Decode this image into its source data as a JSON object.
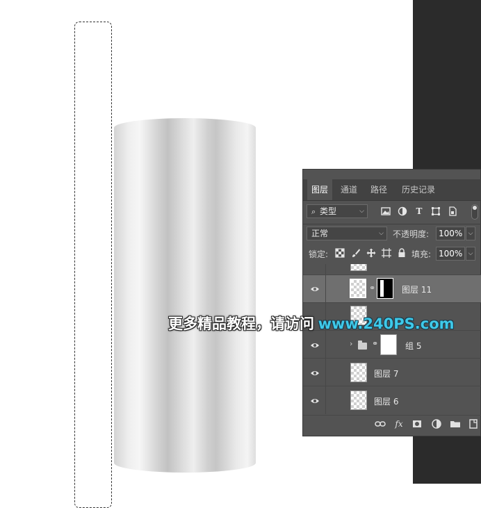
{
  "panel": {
    "tabs": [
      {
        "label": "图层",
        "active": true
      },
      {
        "label": "通道",
        "active": false
      },
      {
        "label": "路径",
        "active": false
      },
      {
        "label": "历史记录",
        "active": false
      }
    ],
    "filter": {
      "kind_label": "类型"
    },
    "blend": {
      "mode": "正常",
      "opacity_label": "不透明度:",
      "opacity_value": "100%"
    },
    "lock": {
      "label": "锁定:",
      "fill_label": "填充:",
      "fill_value": "100%"
    },
    "layers": [
      {
        "name": "",
        "type": "partial"
      },
      {
        "name": "图层 11",
        "type": "layer-with-mask",
        "selected": true,
        "visible": true
      },
      {
        "name": "",
        "type": "obscured",
        "visible": false
      },
      {
        "name": "组 5",
        "type": "group",
        "visible": true
      },
      {
        "name": "图层 7",
        "type": "layer",
        "visible": true
      },
      {
        "name": "图层 6",
        "type": "layer",
        "visible": true
      }
    ]
  },
  "watermark": {
    "text": "更多精品教程，请访问",
    "url": "www.240PS.com"
  },
  "colors": {
    "panel_bg": "#535353",
    "selected_row": "#6f6f6f",
    "watermark_url": "#3ec9e9",
    "right_strip": "#2b2b2b"
  }
}
